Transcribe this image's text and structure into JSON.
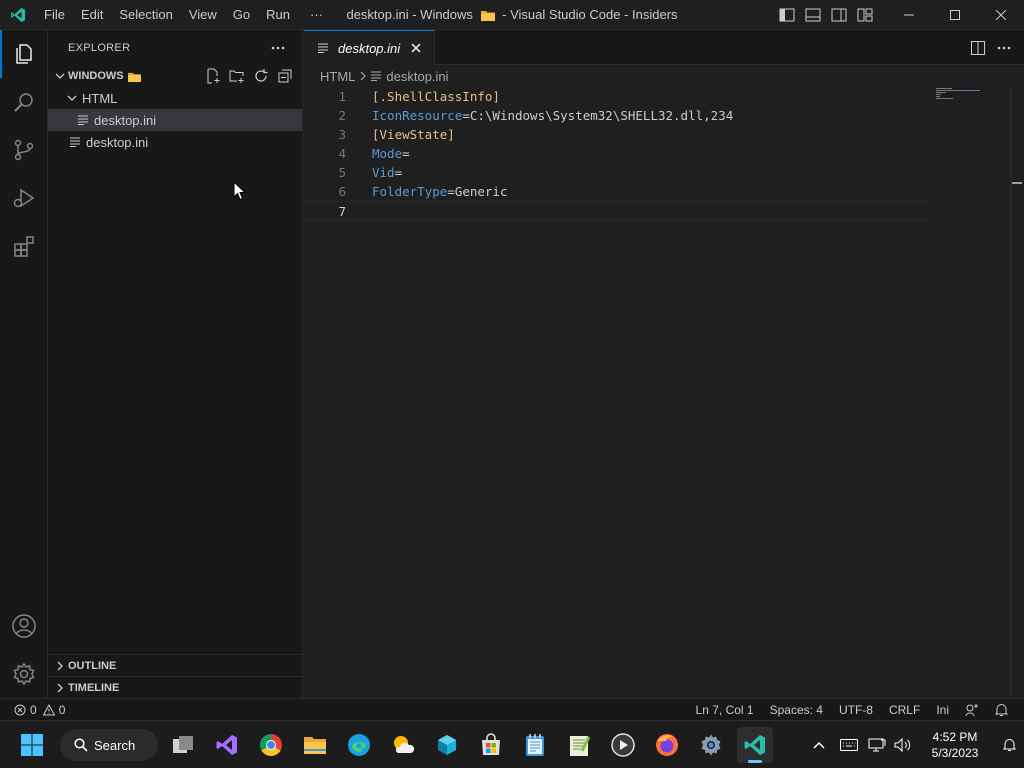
{
  "window": {
    "title_left": "desktop.ini - Windows",
    "title_right": "- Visual Studio Code - Insiders",
    "menu": [
      "File",
      "Edit",
      "Selection",
      "View",
      "Go",
      "Run",
      "···"
    ]
  },
  "activity_bar": {
    "icons": [
      "explorer-icon",
      "search-icon",
      "source-control-icon",
      "run-debug-icon",
      "extensions-icon",
      "accounts-icon",
      "manage-gear-icon"
    ]
  },
  "sidebar": {
    "title": "EXPLORER",
    "more": "···",
    "root_folder": "WINDOWS",
    "tree": [
      {
        "label": "HTML",
        "type": "folder"
      },
      {
        "label": "desktop.ini",
        "type": "file"
      },
      {
        "label": "desktop.ini",
        "type": "file"
      }
    ],
    "sections": [
      "OUTLINE",
      "TIMELINE"
    ]
  },
  "editor": {
    "tab_label": "desktop.ini",
    "breadcrumb": [
      "HTML",
      "desktop.ini"
    ],
    "lines": [
      {
        "n": "1",
        "text": "[.ShellClassInfo]"
      },
      {
        "n": "2",
        "key": "IconResource",
        "value": "C:\\Windows\\System32\\SHELL32.dll,234"
      },
      {
        "n": "3",
        "text": "[ViewState]"
      },
      {
        "n": "4",
        "key": "Mode",
        "value": ""
      },
      {
        "n": "5",
        "key": "Vid",
        "value": ""
      },
      {
        "n": "6",
        "key": "FolderType",
        "value": "Generic"
      },
      {
        "n": "7",
        "text": ""
      }
    ]
  },
  "statusbar": {
    "errors": "0",
    "warnings": "0",
    "position": "Ln 7, Col 1",
    "spaces": "Spaces: 4",
    "encoding": "UTF-8",
    "eol": "CRLF",
    "language": "Ini"
  },
  "taskbar": {
    "search_label": "Search",
    "time": "4:52 PM",
    "date": "5/3/2023"
  },
  "colors": {
    "accent": "#0078d4",
    "section": "#e2c08d",
    "key": "#569cd6"
  }
}
